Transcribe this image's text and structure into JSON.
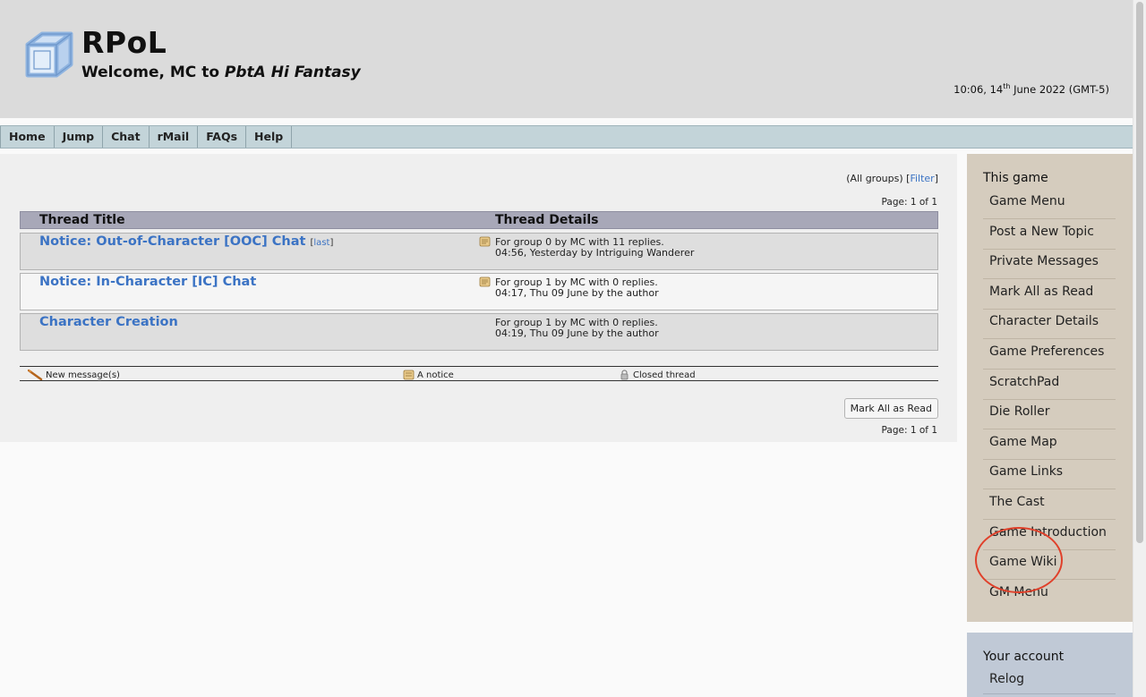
{
  "header": {
    "site_title": "RPoL",
    "welcome_prefix": "Welcome, MC to ",
    "game_name": "PbtA Hi Fantasy",
    "clock_time": "10:06, 14",
    "clock_suffix": "th",
    "clock_rest": " June 2022 (GMT-5)"
  },
  "nav": {
    "tabs": [
      {
        "label": "Home"
      },
      {
        "label": "Jump"
      },
      {
        "label": "Chat"
      },
      {
        "label": "rMail"
      },
      {
        "label": "FAQs"
      },
      {
        "label": "Help"
      }
    ]
  },
  "main": {
    "groups_label": "(All groups) [",
    "filter_link": "Filter",
    "groups_close": "]",
    "page_info_top": "Page: 1 of 1",
    "page_info_bottom": "Page: 1 of 1",
    "columns": {
      "title": "Thread Title",
      "details": "Thread Details"
    },
    "threads": [
      {
        "title": "Notice: Out-of-Character [OOC] Chat",
        "last_open": "[",
        "last_link": "last",
        "last_close": "]",
        "line1": "For group 0 by MC with 11 replies.",
        "line2": "04:56, Yesterday by Intriguing Wanderer"
      },
      {
        "title": "Notice: In-Character [IC] Chat",
        "line1": "For group 1 by MC with 0 replies.",
        "line2": "04:17, Thu 09 June by the author"
      },
      {
        "title": "Character Creation",
        "line1": "For group 1 by MC with 0 replies.",
        "line2": "04:19, Thu 09 June by the author"
      }
    ],
    "legend": {
      "new": "New message(s)",
      "notice": "A notice",
      "closed": "Closed thread"
    },
    "mark_all_button": "Mark All as Read"
  },
  "sidebar": {
    "heading": "This game",
    "items": [
      {
        "label": "Game Menu"
      },
      {
        "label": "Post a New Topic"
      },
      {
        "label": "Private Messages"
      },
      {
        "label": "Mark All as Read"
      },
      {
        "label": "Character Details"
      },
      {
        "label": "Game Preferences"
      },
      {
        "label": "ScratchPad"
      },
      {
        "label": "Die Roller"
      },
      {
        "label": "Game Map"
      },
      {
        "label": "Game Links"
      },
      {
        "label": "The Cast"
      },
      {
        "label": "Game Introduction"
      },
      {
        "label": "Game Wiki"
      },
      {
        "label": "GM Menu"
      }
    ]
  },
  "account": {
    "heading": "Your account",
    "item": "Relog"
  },
  "colors": {
    "link": "#3b73c4",
    "annotation_circle": "#e0402a",
    "sidebar_bg": "#d5ccbe",
    "nav_bg": "#c3d4d9"
  }
}
